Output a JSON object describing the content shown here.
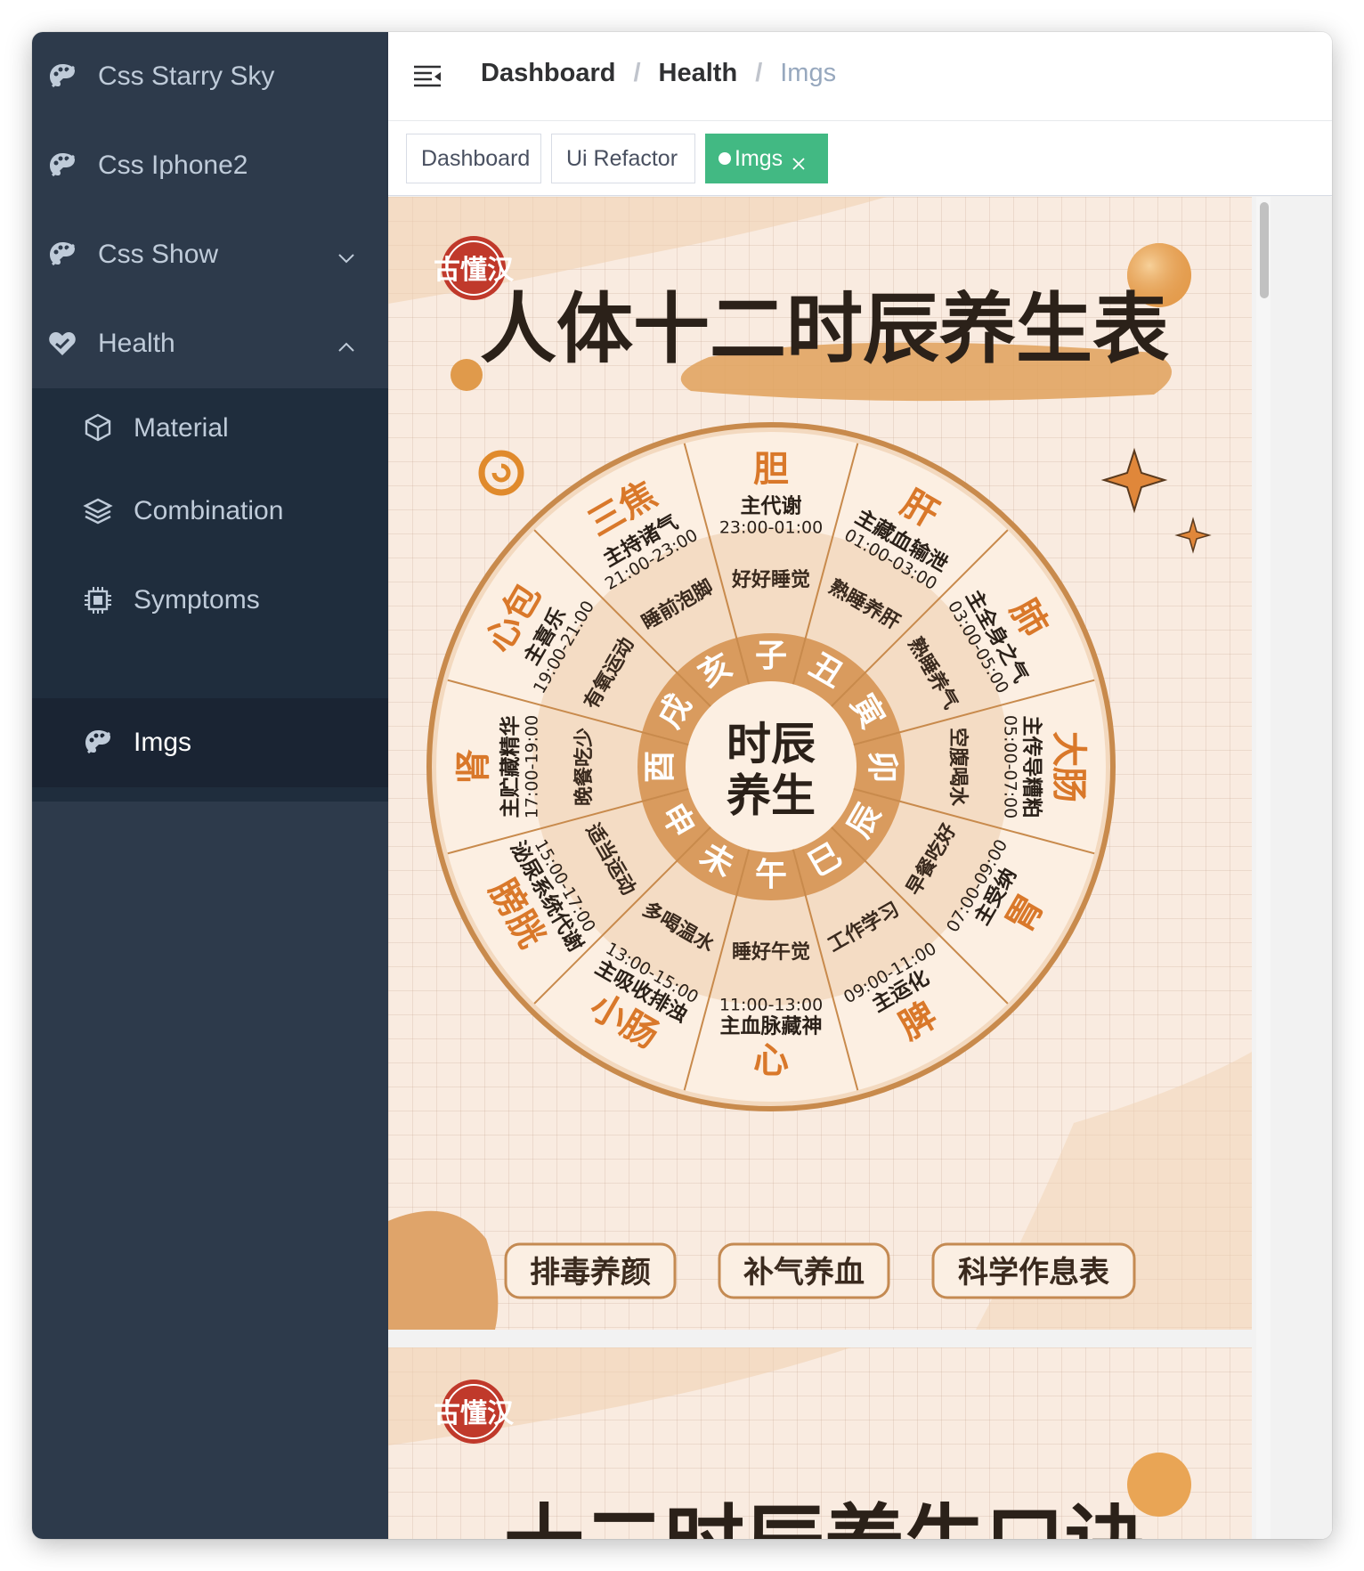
{
  "sidebar": {
    "items": [
      {
        "label": "Css Starry Sky",
        "icon": "palette-icon"
      },
      {
        "label": "Css Iphone2",
        "icon": "palette-icon"
      },
      {
        "label": "Css Show",
        "icon": "palette-icon",
        "arrow": "chevron-down-icon"
      },
      {
        "label": "Health",
        "icon": "heart-icon",
        "arrow": "chevron-up-icon"
      }
    ],
    "health_children": [
      {
        "label": "Material",
        "icon": "cube-icon"
      },
      {
        "label": "Combination",
        "icon": "layers-icon"
      },
      {
        "label": "Symptoms",
        "icon": "chip-icon"
      },
      {
        "label": "Imgs",
        "icon": "palette-icon",
        "active": true
      }
    ]
  },
  "navbar": {
    "breadcrumb": [
      "Dashboard",
      "Health",
      "Imgs"
    ],
    "separator": "/"
  },
  "tags": [
    {
      "label": "Dashboard"
    },
    {
      "label": "Ui Refactor"
    },
    {
      "label": "Imgs",
      "active": true
    }
  ],
  "poster1": {
    "brand": "古懂汉",
    "title": "人体十二时辰养生表",
    "center": [
      "时辰",
      "养生"
    ],
    "branches": [
      "子",
      "丑",
      "寅",
      "卯",
      "辰",
      "巳",
      "午",
      "未",
      "申",
      "酉",
      "戌",
      "亥"
    ],
    "segments": [
      {
        "organ": "胆",
        "role": "主代谢",
        "time": "23:00-01:00",
        "tip": "好好睡觉"
      },
      {
        "organ": "肝",
        "role": "主藏血输泄",
        "time": "01:00-03:00",
        "tip": "熟睡养肝"
      },
      {
        "organ": "肺",
        "role": "主全身之气",
        "time": "03:00-05:00",
        "tip": "熟睡养气"
      },
      {
        "organ": "大肠",
        "role": "主传导糟粕",
        "time": "05:00-07:00",
        "tip": "空腹喝水"
      },
      {
        "organ": "胃",
        "role": "主受纳",
        "time": "07:00-09:00",
        "tip": "早餐吃好"
      },
      {
        "organ": "脾",
        "role": "主运化",
        "time": "09:00-11:00",
        "tip": "工作学习"
      },
      {
        "organ": "心",
        "role": "主血脉藏神",
        "time": "11:00-13:00",
        "tip": "睡好午觉"
      },
      {
        "organ": "小肠",
        "role": "主吸收排浊",
        "time": "13:00-15:00",
        "tip": "多喝温水"
      },
      {
        "organ": "膀胱",
        "role": "泌尿系统代谢",
        "time": "15:00-17:00",
        "tip": "适当运动"
      },
      {
        "organ": "肾",
        "role": "主贮藏精华",
        "time": "17:00-19:00",
        "tip": "晚餐吃少"
      },
      {
        "organ": "心包",
        "role": "主喜乐",
        "time": "19:00-21:00",
        "tip": "有氧运动"
      },
      {
        "organ": "三焦",
        "role": "主持诸气",
        "time": "21:00-23:00",
        "tip": "睡前泡脚"
      }
    ],
    "buttons": [
      "排毒养颜",
      "补气养血",
      "科学作息表"
    ]
  },
  "poster2": {
    "brand": "古懂汉",
    "title": "十二时辰养生口诀"
  },
  "colors": {
    "sidebar_bg": "#2d3a4b",
    "active_tag": "#42b983",
    "poster_orange": "#d2893a",
    "poster_red": "#c0392b"
  }
}
